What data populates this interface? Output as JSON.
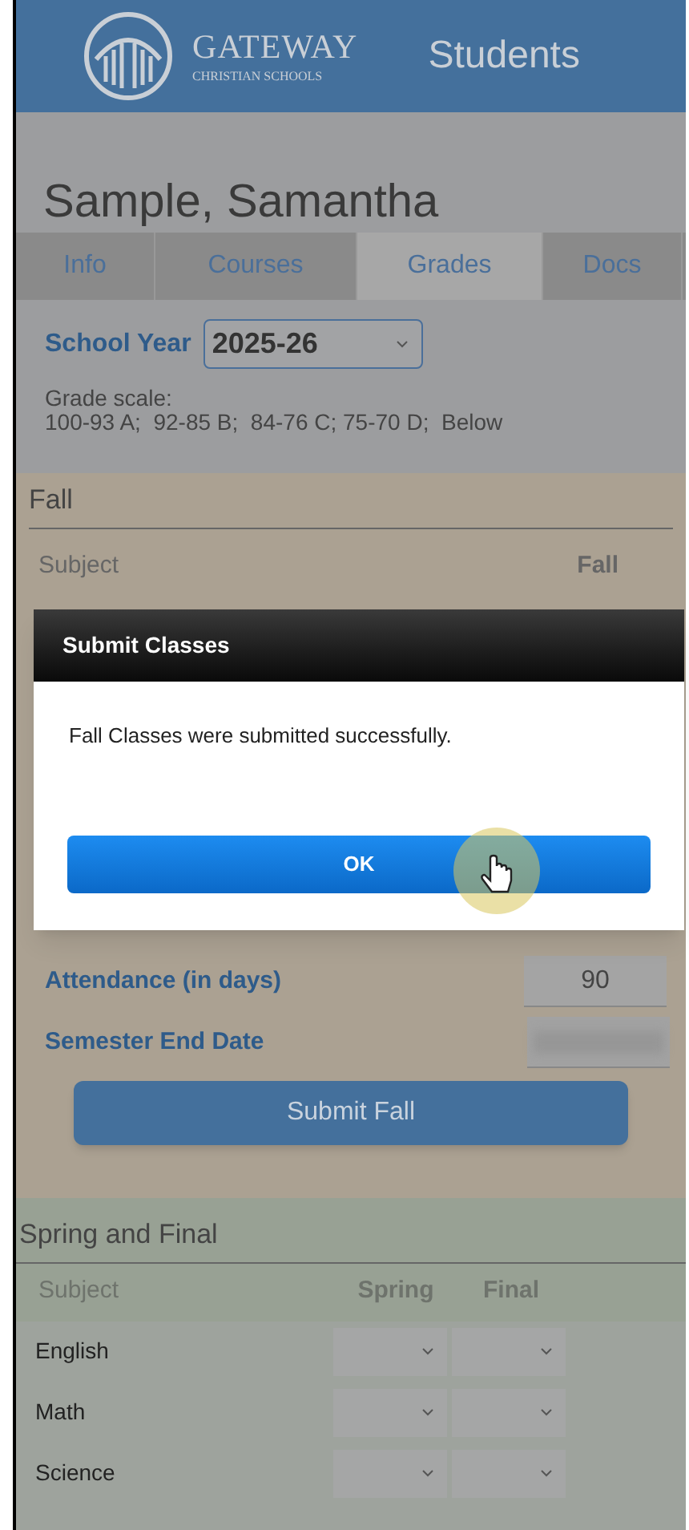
{
  "header": {
    "logo_name": "GATEWAY",
    "logo_sub": "CHRISTIAN SCHOOLS",
    "title": "Students"
  },
  "student_name": "Sample, Samantha",
  "tabs": [
    {
      "label": "Info",
      "selected": false
    },
    {
      "label": "Courses",
      "selected": false
    },
    {
      "label": "Grades",
      "selected": true
    },
    {
      "label": "Docs",
      "selected": false
    }
  ],
  "school_year": {
    "label": "School Year",
    "value": "2025-26"
  },
  "grade_scale": {
    "title": "Grade scale:",
    "text": "100-93 A;  92-85 B;  84-76 C; 75-70 D;  Below"
  },
  "fall": {
    "title": "Fall",
    "columns": [
      "Subject",
      "Fall"
    ],
    "attendance": {
      "label": "Attendance (in days)",
      "value": "90"
    },
    "end_date": {
      "label": "Semester End Date"
    },
    "submit": "Submit Fall"
  },
  "spring": {
    "title": "Spring and Final",
    "columns": [
      "Subject",
      "Spring",
      "Final"
    ],
    "rows": [
      {
        "subject": "English"
      },
      {
        "subject": "Math"
      },
      {
        "subject": "Science"
      }
    ]
  },
  "dialog": {
    "title": "Submit Classes",
    "message": "Fall Classes were submitted successfully.",
    "button": "OK"
  }
}
